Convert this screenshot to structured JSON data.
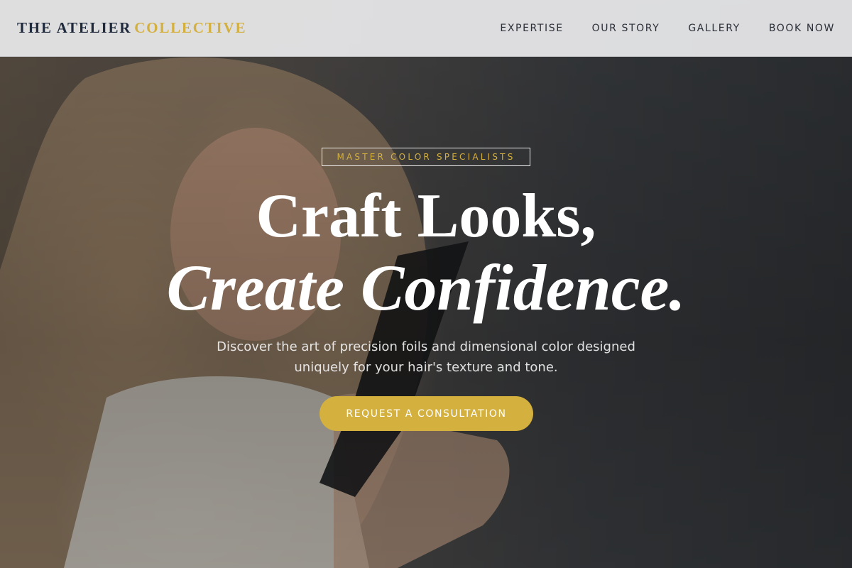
{
  "header": {
    "logo_main": "THE ATELIER",
    "logo_accent": "COLLECTIVE",
    "nav": [
      "EXPERTISE",
      "OUR STORY",
      "GALLERY",
      "BOOK NOW"
    ]
  },
  "hero": {
    "eyebrow": "MASTER COLOR SPECIALISTS",
    "headline_line1": "Craft Looks,",
    "headline_line2": "Create Confidence.",
    "subtitle": "Discover the art of precision foils and dimensional color designed uniquely for your hair's texture and tone.",
    "cta_label": "REQUEST A CONSULTATION"
  },
  "colors": {
    "accent": "#d4b03f",
    "header_bg": "#e8e8ea",
    "logo": "#1f2a3c",
    "hero_overlay": "#3a3d42"
  }
}
